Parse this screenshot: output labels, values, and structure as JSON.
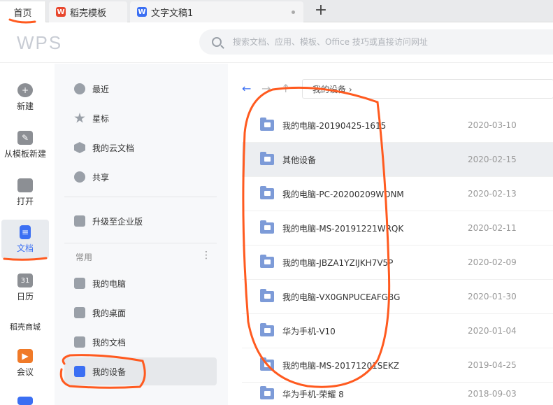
{
  "tabs": [
    {
      "label": "首页"
    },
    {
      "label": "稻壳模板"
    },
    {
      "label": "文字文稿1"
    }
  ],
  "header": {
    "logo": "WPS",
    "search_placeholder": "搜索文档、应用、模板、Office 技巧或直接访问网址"
  },
  "leftnav": [
    {
      "label": "新建",
      "icon": "plus-circle-icon"
    },
    {
      "label": "从模板新建",
      "icon": "template-icon"
    },
    {
      "label": "打开",
      "icon": "folder-icon"
    },
    {
      "label": "文档",
      "icon": "document-icon"
    },
    {
      "label": "日历",
      "icon": "calendar-icon"
    },
    {
      "label": "稻壳商城",
      "icon": "store-icon"
    },
    {
      "label": "会议",
      "icon": "meeting-icon"
    }
  ],
  "sidebar": {
    "items": [
      {
        "label": "最近",
        "icon": "clock-icon"
      },
      {
        "label": "星标",
        "icon": "star-icon"
      },
      {
        "label": "我的云文档",
        "icon": "cloud-doc-icon"
      },
      {
        "label": "共享",
        "icon": "share-users-icon"
      },
      {
        "label": "升级至企业版",
        "icon": "enterprise-icon"
      }
    ],
    "section_title": "常用",
    "common": [
      {
        "label": "我的电脑",
        "icon": "computer-shortcut-icon"
      },
      {
        "label": "我的桌面",
        "icon": "desktop-shortcut-icon"
      },
      {
        "label": "我的文档",
        "icon": "documents-shortcut-icon"
      },
      {
        "label": "我的设备",
        "icon": "devices-icon"
      }
    ]
  },
  "main": {
    "path": "我的设备  ›",
    "rows": [
      {
        "name": "我的电脑-20190425-1615",
        "date": "2020-03-10"
      },
      {
        "name": "其他设备",
        "date": "2020-02-15"
      },
      {
        "name": "我的电脑-PC-20200209WDNM",
        "date": "2020-02-13"
      },
      {
        "name": "我的电脑-MS-20191221WRQK",
        "date": "2020-02-11"
      },
      {
        "name": "我的电脑-JBZA1YZIJKH7V5P",
        "date": "2020-02-09"
      },
      {
        "name": "我的电脑-VX0GNPUCEAFGBG",
        "date": "2020-01-30"
      },
      {
        "name": "华为手机-V10",
        "date": "2020-01-04"
      },
      {
        "name": "我的电脑-MS-20171201SEKZ",
        "date": "2019-04-25"
      },
      {
        "name": "华为手机-荣耀 8",
        "date": "2018-09-03"
      }
    ]
  },
  "colors": {
    "accent": "#3b6ff3",
    "annotation": "#ff5a1f"
  }
}
